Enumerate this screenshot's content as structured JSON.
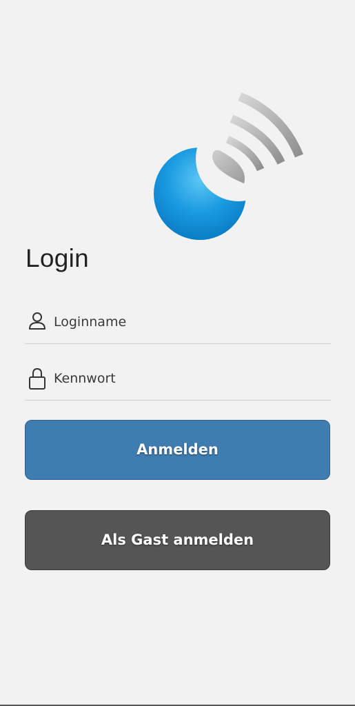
{
  "app": {
    "logo_icon": "nfc-signal-logo",
    "colors": {
      "background": "#f2f2f2",
      "primary_button": "#3f7db1",
      "secondary_button": "#555555",
      "logo_blue": "#0f8fd6"
    }
  },
  "login": {
    "title": "Login",
    "username": {
      "icon": "user-icon",
      "placeholder": "Loginname",
      "value": ""
    },
    "password": {
      "icon": "lock-icon",
      "placeholder": "Kennwort",
      "value": ""
    },
    "submit_label": "Anmelden",
    "guest_label": "Als Gast anmelden"
  }
}
